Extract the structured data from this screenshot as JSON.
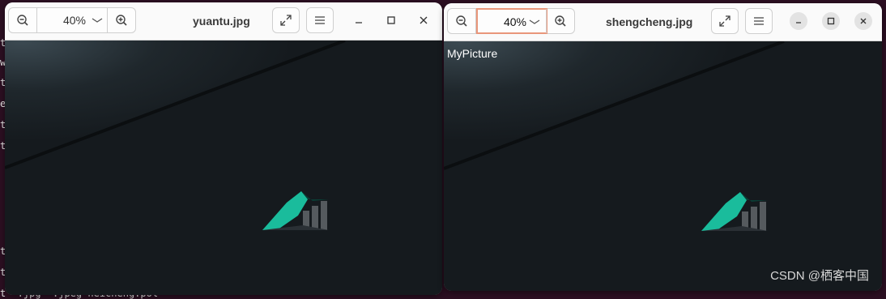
{
  "terminal": {
    "fragments": [
      "t",
      "w",
      "t",
      "e",
      "t",
      "t",
      "t",
      "t",
      "t   *.jpg  *.jpeg-neicheng.pol"
    ]
  },
  "window_left": {
    "zoom": {
      "value": "40%"
    },
    "title": "yuantu.jpg"
  },
  "window_right": {
    "zoom": {
      "value": "40%"
    },
    "title": "shengcheng.jpg",
    "overlay_text": "MyPicture"
  },
  "watermark": "CSDN @栖客中国",
  "icons": [
    "zoom-out-icon",
    "chevron-down-icon",
    "zoom-in-icon",
    "fullscreen-icon",
    "menu-icon",
    "minimize-icon",
    "maximize-icon",
    "close-icon",
    "logo-icon"
  ],
  "colors": {
    "canvas_bg": "#151a1e",
    "focus_border": "#e9967a",
    "desktop_bg": "#2c0f22",
    "logo_green": "#1abc9c"
  }
}
